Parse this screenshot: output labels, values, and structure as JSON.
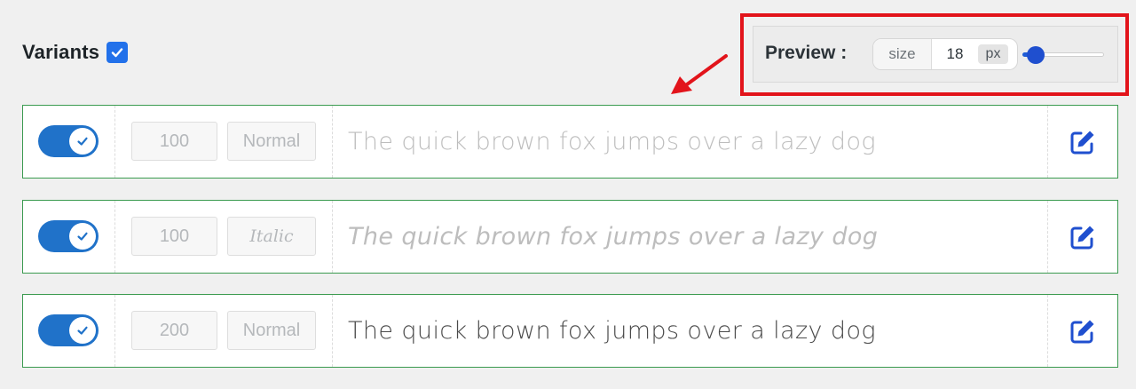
{
  "variants": {
    "title": "Variants",
    "checked": true
  },
  "preview": {
    "label": "Preview :",
    "size_label": "size",
    "size_value": "18",
    "unit": "px",
    "slider_fraction": 0.03
  },
  "rows": [
    {
      "weight": "100",
      "style": "Normal",
      "sample": "The quick brown fox jumps over a lazy dog",
      "enabled": true
    },
    {
      "weight": "100",
      "style": "Italic",
      "sample": "The quick brown fox jumps over a lazy dog",
      "enabled": true
    },
    {
      "weight": "200",
      "style": "Normal",
      "sample": "The quick brown fox jumps over a lazy dog",
      "enabled": true
    }
  ],
  "colors": {
    "accent": "#2072c9",
    "row_border": "#3a9a4f",
    "annotation": "#e2141b",
    "edit_icon": "#1f4fcf"
  },
  "icons": {
    "checkbox": "check-icon",
    "toggle": "check-circle-icon",
    "edit": "edit-icon",
    "arrow": "arrow-icon"
  }
}
